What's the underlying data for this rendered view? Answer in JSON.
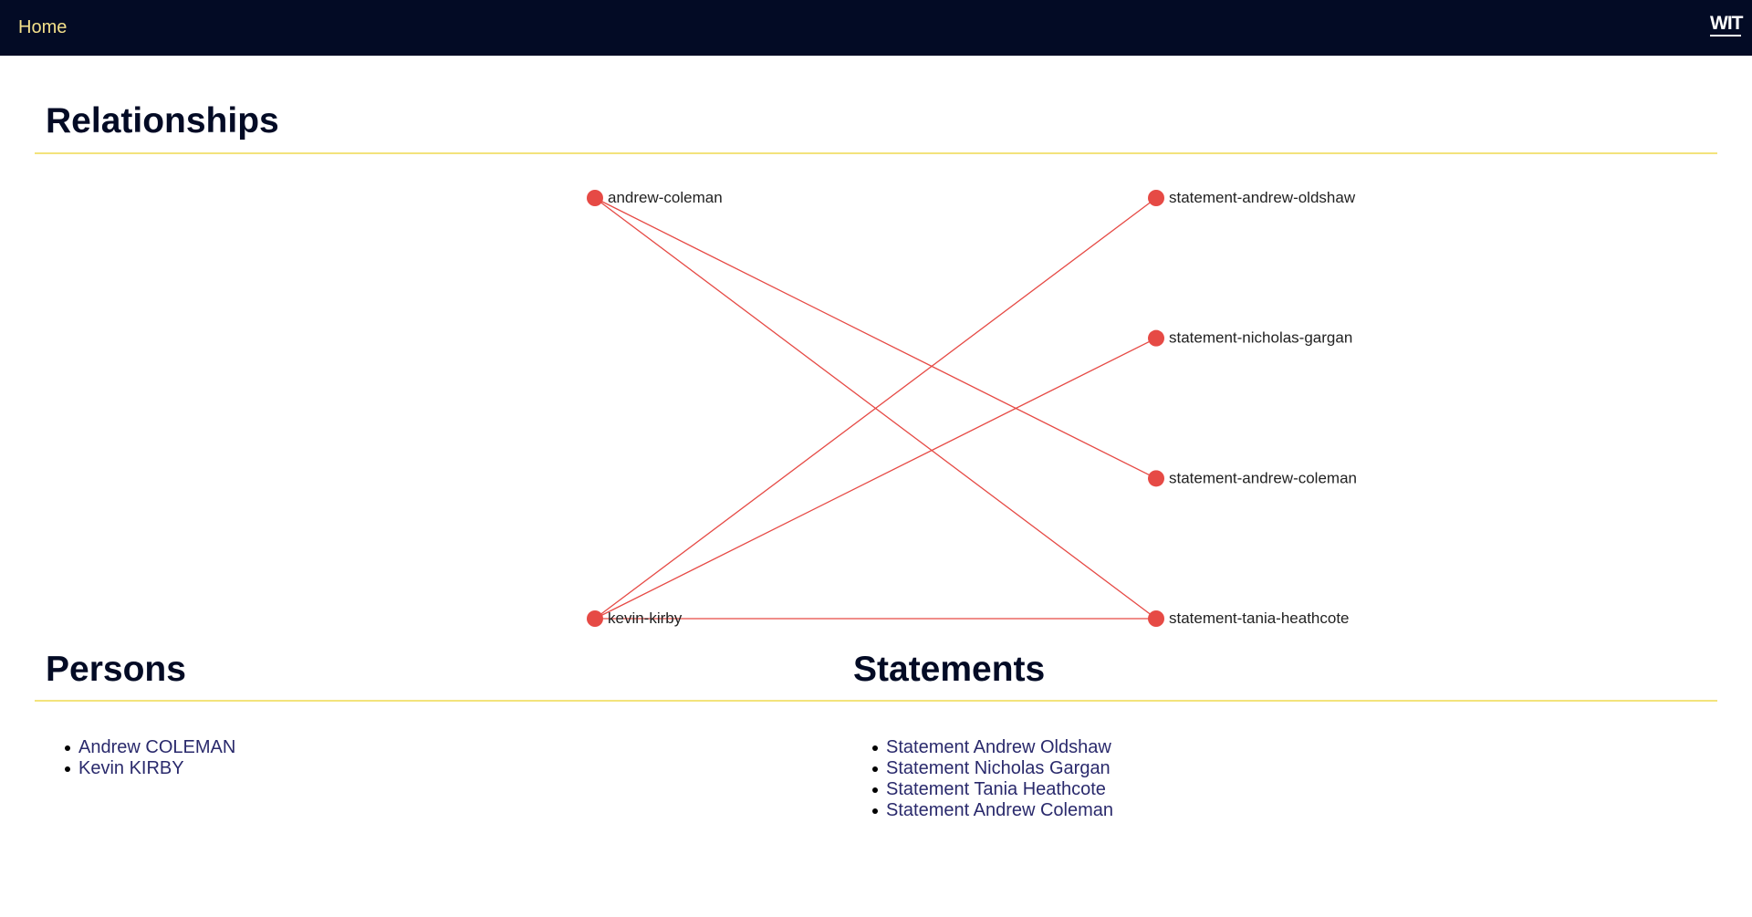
{
  "nav": {
    "home_label": "Home",
    "logo_text": "WIT"
  },
  "colors": {
    "navbar_bg": "#030b25",
    "nav_link": "#f3e08a",
    "heading": "#030b25",
    "rule": "#f3e37c",
    "node": "#e64a45",
    "edge": "#e64a45",
    "link": "#2a2a6c"
  },
  "relationships": {
    "title": "Relationships",
    "persons": [
      "andrew-coleman",
      "kevin-kirby"
    ],
    "statements": [
      "statement-andrew-oldshaw",
      "statement-nicholas-gargan",
      "statement-andrew-coleman",
      "statement-tania-heathcote"
    ],
    "edges": [
      {
        "from": "andrew-coleman",
        "to": "statement-andrew-coleman"
      },
      {
        "from": "andrew-coleman",
        "to": "statement-tania-heathcote"
      },
      {
        "from": "kevin-kirby",
        "to": "statement-andrew-oldshaw"
      },
      {
        "from": "kevin-kirby",
        "to": "statement-nicholas-gargan"
      },
      {
        "from": "kevin-kirby",
        "to": "statement-tania-heathcote"
      }
    ]
  },
  "persons": {
    "title": "Persons",
    "items": [
      "Andrew COLEMAN",
      "Kevin KIRBY"
    ]
  },
  "statements": {
    "title": "Statements",
    "items": [
      "Statement Andrew Oldshaw",
      "Statement Nicholas Gargan",
      "Statement Tania Heathcote",
      "Statement Andrew Coleman"
    ]
  }
}
